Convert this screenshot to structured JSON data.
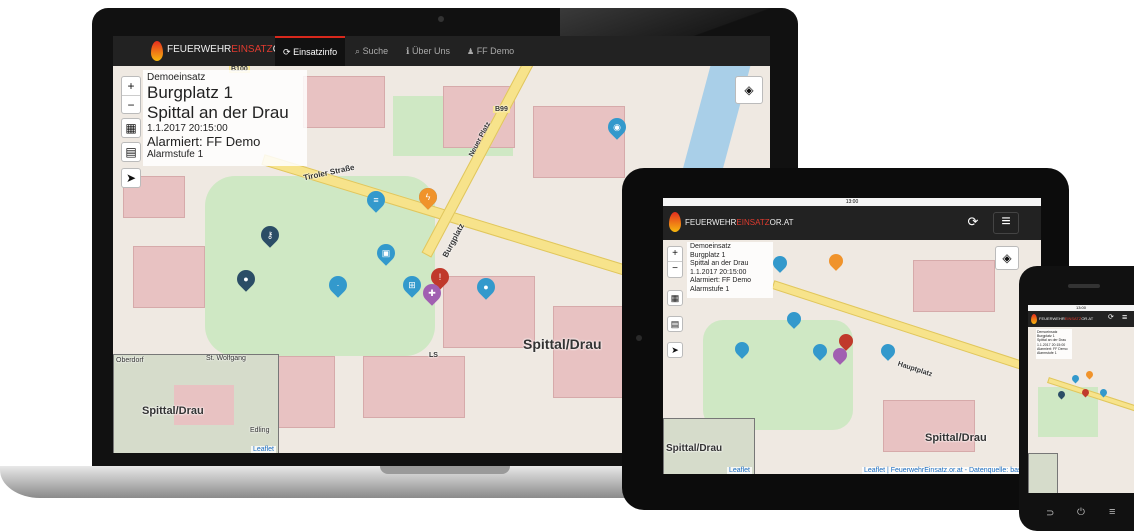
{
  "brand": {
    "part1": "FEUERWEHR",
    "part2": "EINSATZ",
    "part3": "OR.AT"
  },
  "nav": {
    "einsatzinfo": "Einsatzinfo",
    "suche": "Suche",
    "ueber_uns": "Über Uns",
    "ff_demo": "FF Demo"
  },
  "icons": {
    "refresh": "⟳",
    "search": "⌕",
    "info": "ℹ",
    "user": "👤",
    "zoom_in": "+",
    "zoom_out": "−",
    "map": "▦",
    "doc": "▤",
    "locate": "➤",
    "menu": "≡",
    "layers": "◈"
  },
  "incident": {
    "title": "Demoeinsatz",
    "street": "Burgplatz 1",
    "city": "Spittal an der Drau",
    "datetime": "1.1.2017 20:15:00",
    "alarmed": "Alarmiert: FF Demo",
    "level": "Alarmstufe 1"
  },
  "map": {
    "city_label": "Spittal/Drau",
    "street_tiroler": "Tiroler Straße",
    "street_hauptplatz": "Hauptplatz",
    "street_burgplatz": "Burgplatz",
    "street_neuer_platz": "Neuer Platz",
    "road_b99": "B99",
    "road_b100": "B100",
    "road_ls": "LS",
    "minimap_oberdorf": "Oberdorf",
    "minimap_stwolfgang": "St. Wolfgang",
    "minimap_city": "Spittal/Drau",
    "minimap_edling": "Edling"
  },
  "attribution": {
    "leaflet": "Leaflet",
    "tablet_full": "Leaflet | FeuerwehrEinsatz.or.at - Datenquelle: basemap"
  },
  "colors": {
    "brand_red": "#d8281c",
    "topbar": "#222222",
    "pin_blue": "#3399cc",
    "pin_dark": "#2b4d66",
    "pin_orange": "#f0932b",
    "pin_red": "#c0392b",
    "pin_purple": "#a15fb1"
  },
  "tablet": {
    "status_time": "13:00"
  },
  "phone": {
    "status_time": "13:00"
  }
}
